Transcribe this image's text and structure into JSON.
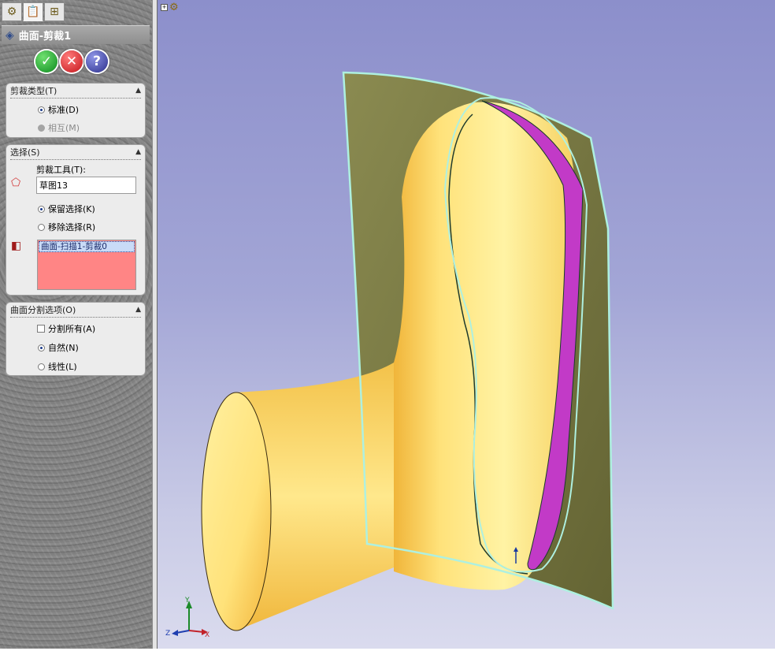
{
  "panel": {
    "tabs": [
      {
        "icon": "featuremanager-icon",
        "active": false
      },
      {
        "icon": "propertymanager-icon",
        "active": true
      },
      {
        "icon": "configurationmanager-icon",
        "active": false
      }
    ],
    "title": "曲面-剪裁1",
    "actions": {
      "ok": "✓",
      "cancel": "✕",
      "help": "?"
    },
    "trim_type": {
      "header": "剪裁类型(T)",
      "options": [
        {
          "label": "标准(D)",
          "selected": true,
          "enabled": true
        },
        {
          "label": "相互(M)",
          "selected": false,
          "enabled": false
        }
      ]
    },
    "selections": {
      "header": "选择(S)",
      "trim_tool_label": "剪裁工具(T):",
      "trim_tool_value": "草图13",
      "options": [
        {
          "label": "保留选择(K)",
          "selected": true
        },
        {
          "label": "移除选择(R)",
          "selected": false
        }
      ],
      "list_items": [
        "曲面-扫描1-剪裁0"
      ]
    },
    "split_options": {
      "header": "曲面分割选项(O)",
      "split_all": {
        "label": "分割所有(A)",
        "checked": false
      },
      "options": [
        {
          "label": "自然(N)",
          "selected": true
        },
        {
          "label": "线性(L)",
          "selected": false
        }
      ]
    }
  },
  "viewport": {
    "tree_node_icon": "part-icon",
    "tree_node_label": "",
    "triad": {
      "y": "Y",
      "z": "Z",
      "x": "X"
    },
    "colors": {
      "body": "#f8e06a",
      "trim_surface": "#7a7a3a",
      "selected_edge": "#aef0e0",
      "removed_face": "#c23ac7"
    }
  }
}
